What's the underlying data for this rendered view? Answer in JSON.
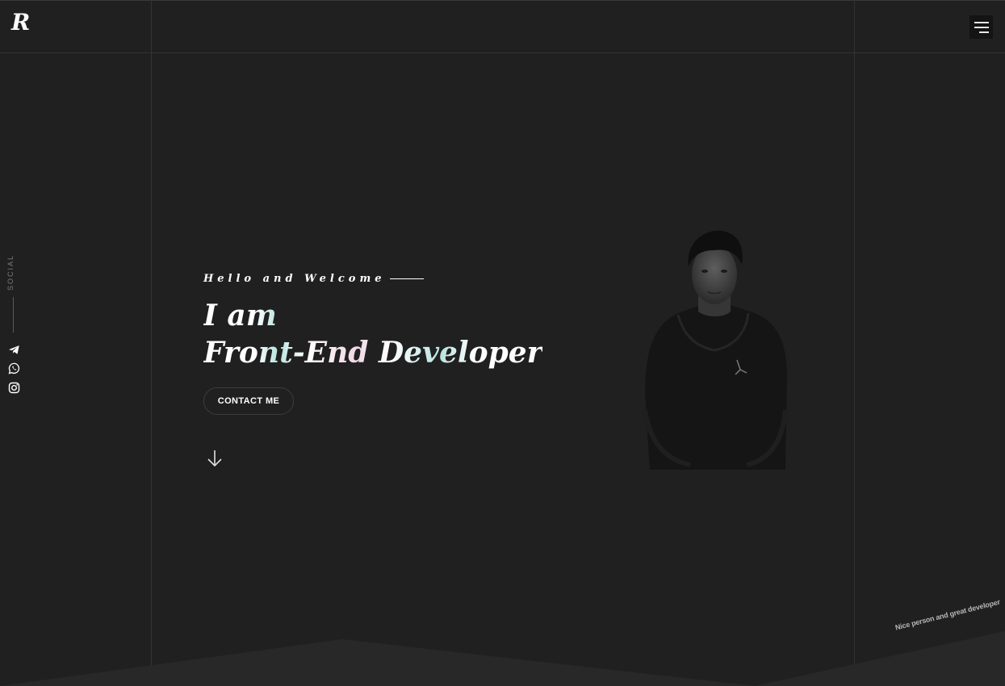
{
  "header": {
    "logo_text": "R",
    "menu_icon": "hamburger-menu-icon"
  },
  "social": {
    "label": "SOCIAL",
    "items": [
      {
        "name": "telegram",
        "icon": "telegram-icon"
      },
      {
        "name": "whatsapp",
        "icon": "whatsapp-icon"
      },
      {
        "name": "instagram",
        "icon": "instagram-icon"
      }
    ]
  },
  "hero": {
    "welcome": "Hello and Welcome",
    "headline_line1": "I am",
    "headline_line2": "Front-End Developer",
    "contact_label": "CONTACT ME",
    "scroll_icon": "arrow-down-icon"
  },
  "footer": {
    "tagline": "Nice person and great developer"
  },
  "colors": {
    "background": "#202020",
    "grid_line": "#333333",
    "bottom_shape": "#2a2a2a",
    "text": "#ffffff",
    "accent_gradient": "#b8e3df"
  }
}
